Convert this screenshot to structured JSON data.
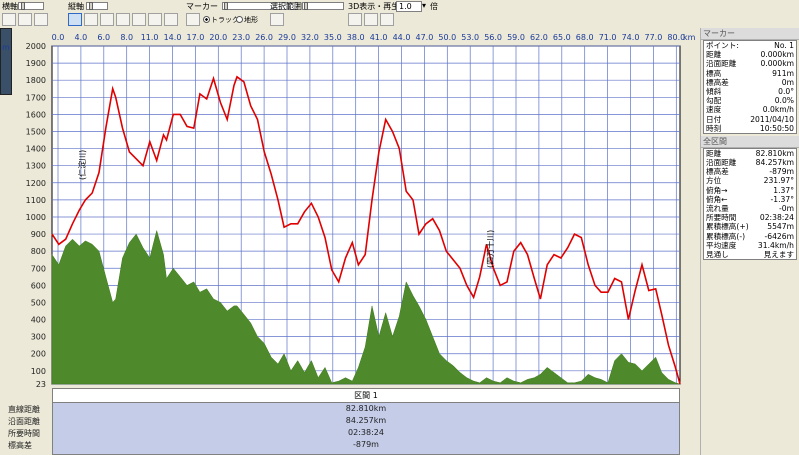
{
  "toolbar": {
    "horizontal_label": "横軸",
    "vertical_label": "縦軸",
    "marker_label": "マーカー",
    "range_label": "選択範囲",
    "playback_label": "3D表示・再生",
    "speed_value": "1.0",
    "speed_unit": "倍",
    "track_label": "トラック",
    "terrain_label": "地形",
    "selected_mode": "track"
  },
  "panel": {
    "marker_title": "マーカー",
    "marker_rows": [
      {
        "label": "ポイント:",
        "value": "No. 1"
      },
      {
        "label": "距離",
        "value": "0.000km"
      },
      {
        "label": "沿面距離",
        "value": "0.000km"
      },
      {
        "label": "標高",
        "value": "911m"
      },
      {
        "label": "標高差",
        "value": "0m"
      },
      {
        "label": "傾斜",
        "value": "0.0°"
      },
      {
        "label": "勾配",
        "value": "0.0%"
      },
      {
        "label": "速度",
        "value": "0.0km/h"
      },
      {
        "label": "日付",
        "value": "2011/04/10"
      },
      {
        "label": "時刻",
        "value": "10:50:50"
      }
    ],
    "range_title": "全区間",
    "range_rows": [
      {
        "label": "距離",
        "value": "82.810km"
      },
      {
        "label": "沿面距離",
        "value": "84.257km"
      },
      {
        "label": "標高差",
        "value": "-879m"
      },
      {
        "label": "方位",
        "value": "231.97°"
      },
      {
        "label": "俯角→",
        "value": "1.37°"
      },
      {
        "label": "俯角←",
        "value": "-1.37°"
      },
      {
        "label": "流れ量",
        "value": "-0m"
      },
      {
        "label": "所要時間",
        "value": "02:38:24"
      },
      {
        "label": "累積標高(+)",
        "value": "5547m"
      },
      {
        "label": "累積標高(-)",
        "value": "-6426m"
      },
      {
        "label": "平均速度",
        "value": "31.4km/h"
      },
      {
        "label": "見通し",
        "value": "見えます"
      }
    ]
  },
  "summary": {
    "labels": [
      "直線距離",
      "沿面距離",
      "所要時間",
      "標高差"
    ],
    "header": "区間 1",
    "values": [
      "82.810km",
      "84.257km",
      "02:38:24",
      "-879m"
    ]
  },
  "chart_data": {
    "type": "area",
    "x_unit": "km",
    "y_unit": "m",
    "xlim": [
      0,
      82.81
    ],
    "ylim": [
      23,
      2000
    ],
    "x_ticks": [
      "0.0",
      "4.0",
      "6.0",
      "8.0",
      "11.0",
      "14.0",
      "17.0",
      "20.0",
      "23.0",
      "26.0",
      "29.0",
      "32.0",
      "35.0",
      "38.0",
      "41.0",
      "44.0",
      "47.0",
      "50.0",
      "53.0",
      "56.0",
      "59.0",
      "62.0",
      "65.0",
      "68.0",
      "71.0",
      "74.0",
      "77.0",
      "80.0"
    ],
    "y_ticks": [
      "2000",
      "1900",
      "1800",
      "1700",
      "1600",
      "1500",
      "1400",
      "1300",
      "1200",
      "1100",
      "1000",
      "900",
      "800",
      "700",
      "600",
      "500",
      "400",
      "300",
      "200",
      "100",
      "23"
    ],
    "annotations": [
      "(仁淀川)",
      "(四万十川)"
    ],
    "series": [
      {
        "name": "track",
        "color": "#e00000",
        "x": [
          0,
          0.9,
          1.8,
          2.7,
          3.6,
          4.4,
          5.3,
          6.2,
          7.1,
          8.0,
          8.4,
          9.3,
          10.2,
          11.1,
          12.0,
          12.9,
          13.8,
          14.7,
          15.1,
          16.0,
          16.9,
          17.8,
          18.7,
          19.5,
          20.4,
          21.3,
          22.2,
          23.1,
          24.0,
          24.4,
          25.3,
          26.2,
          27.1,
          28.0,
          28.9,
          29.8,
          30.6,
          31.5,
          32.4,
          33.3,
          34.2,
          35.1,
          36.0,
          36.9,
          37.8,
          38.7,
          39.6,
          40.4,
          41.3,
          42.2,
          43.1,
          44.0,
          44.9,
          45.8,
          46.7,
          47.6,
          48.4,
          49.3,
          50.2,
          51.1,
          52.0,
          52.9,
          53.8,
          54.7,
          55.6,
          56.4,
          57.3,
          58.2,
          59.1,
          60.0,
          60.9,
          61.8,
          62.7,
          63.6,
          64.4,
          65.3,
          66.2,
          67.1,
          68.0,
          68.9,
          69.8,
          70.7,
          71.6,
          72.4,
          73.3,
          74.2,
          75.1,
          76.0,
          76.9,
          77.8,
          78.7,
          79.6,
          80.4,
          81.3,
          82.2,
          82.81
        ],
        "y": [
          900,
          840,
          870,
          960,
          1040,
          1100,
          1140,
          1260,
          1520,
          1750,
          1700,
          1520,
          1380,
          1340,
          1300,
          1440,
          1330,
          1480,
          1450,
          1600,
          1600,
          1530,
          1520,
          1720,
          1690,
          1810,
          1670,
          1570,
          1770,
          1820,
          1790,
          1650,
          1570,
          1380,
          1250,
          1100,
          940,
          960,
          960,
          1030,
          1080,
          1000,
          880,
          690,
          620,
          760,
          850,
          720,
          780,
          1100,
          1380,
          1570,
          1500,
          1400,
          1150,
          1100,
          900,
          960,
          990,
          920,
          800,
          750,
          700,
          600,
          530,
          650,
          840,
          700,
          600,
          620,
          800,
          850,
          780,
          640,
          520,
          720,
          780,
          760,
          820,
          900,
          880,
          720,
          600,
          560,
          560,
          640,
          620,
          400,
          570,
          720,
          570,
          580,
          430,
          250,
          120,
          20
        ]
      },
      {
        "name": "terrain",
        "color": "#4e8a2c",
        "x": [
          0,
          0.9,
          1.8,
          2.7,
          3.6,
          4.4,
          5.3,
          6.2,
          7.1,
          8.0,
          8.4,
          9.3,
          10.2,
          11.1,
          12.0,
          12.9,
          13.8,
          14.7,
          15.1,
          16.0,
          16.9,
          17.8,
          18.7,
          19.5,
          20.4,
          21.3,
          22.2,
          23.1,
          24.0,
          24.4,
          25.3,
          26.2,
          27.1,
          28.0,
          28.9,
          29.8,
          30.6,
          31.5,
          32.4,
          33.3,
          34.2,
          35.1,
          36.0,
          36.9,
          37.8,
          38.7,
          39.6,
          40.4,
          41.3,
          42.2,
          43.1,
          44.0,
          44.9,
          45.8,
          46.7,
          47.6,
          48.4,
          49.3,
          50.2,
          51.1,
          52.0,
          52.9,
          53.8,
          54.7,
          55.6,
          56.4,
          57.3,
          58.2,
          59.1,
          60.0,
          60.9,
          61.8,
          62.7,
          63.6,
          64.4,
          65.3,
          66.2,
          67.1,
          68.0,
          68.9,
          69.8,
          70.7,
          71.6,
          72.4,
          73.3,
          74.2,
          75.1,
          76.0,
          76.9,
          77.8,
          78.7,
          79.6,
          80.4,
          81.3,
          82.2,
          82.81
        ],
        "y": [
          780,
          720,
          830,
          870,
          830,
          860,
          840,
          800,
          650,
          500,
          520,
          760,
          850,
          900,
          820,
          760,
          920,
          780,
          640,
          700,
          650,
          600,
          620,
          560,
          580,
          520,
          500,
          450,
          480,
          480,
          430,
          380,
          300,
          260,
          180,
          140,
          200,
          100,
          160,
          90,
          160,
          60,
          120,
          30,
          40,
          60,
          40,
          120,
          240,
          480,
          300,
          440,
          300,
          420,
          620,
          540,
          480,
          400,
          300,
          200,
          160,
          130,
          90,
          60,
          40,
          30,
          60,
          40,
          30,
          60,
          40,
          30,
          50,
          60,
          80,
          120,
          90,
          60,
          30,
          30,
          40,
          80,
          60,
          50,
          30,
          160,
          200,
          150,
          140,
          100,
          140,
          180,
          90,
          50,
          30,
          23
        ]
      }
    ]
  }
}
